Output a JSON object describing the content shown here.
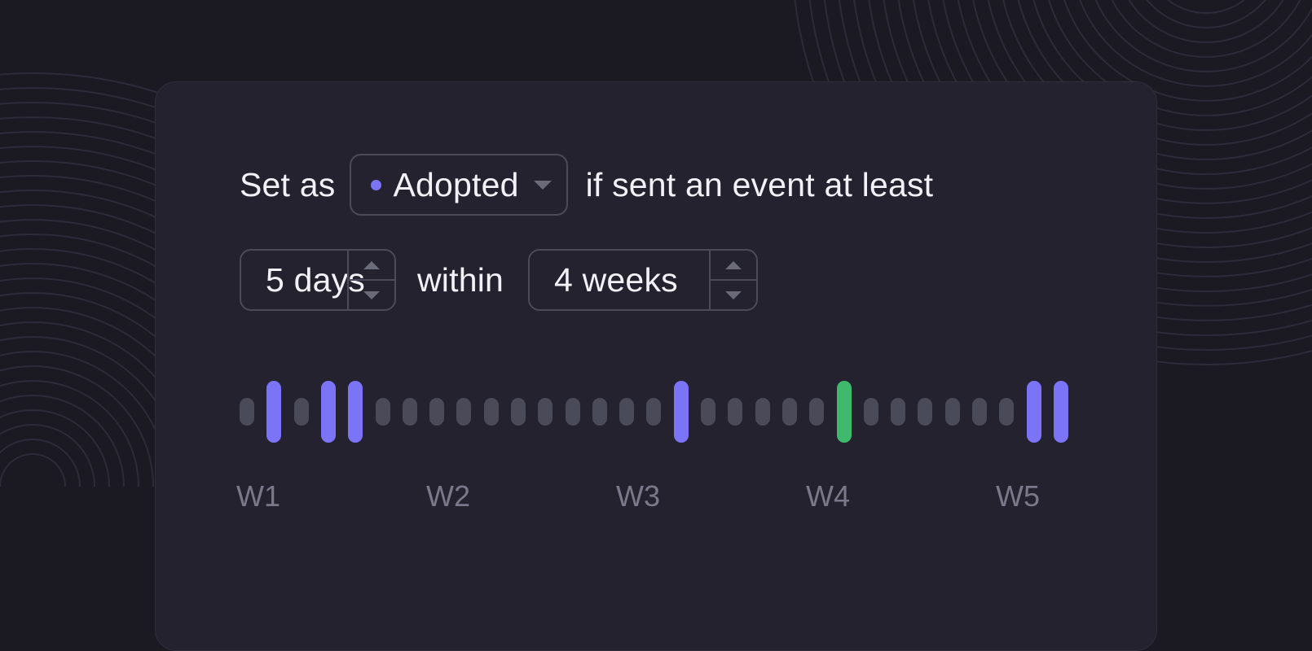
{
  "colors": {
    "accent": "#7b74f7",
    "success": "#3fba6d",
    "inactive": "#4b4a59"
  },
  "rule": {
    "prefix": "Set as",
    "status_select": {
      "value": "Adopted",
      "icon": "purple-dot-icon"
    },
    "suffix": "if sent an event at least",
    "days_stepper": {
      "value": "5 days"
    },
    "within_label": "within",
    "weeks_stepper": {
      "value": "4 weeks"
    }
  },
  "activity": {
    "days": [
      "inactive",
      "active",
      "inactive",
      "active",
      "active",
      "inactive",
      "inactive",
      "inactive",
      "inactive",
      "inactive",
      "inactive",
      "inactive",
      "inactive",
      "inactive",
      "inactive",
      "inactive",
      "active",
      "inactive",
      "inactive",
      "inactive",
      "inactive",
      "inactive",
      "adopted",
      "inactive",
      "inactive",
      "inactive",
      "inactive",
      "inactive",
      "inactive",
      "active",
      "active"
    ],
    "week_labels": [
      "W1",
      "W2",
      "W3",
      "W4",
      "W5"
    ]
  }
}
